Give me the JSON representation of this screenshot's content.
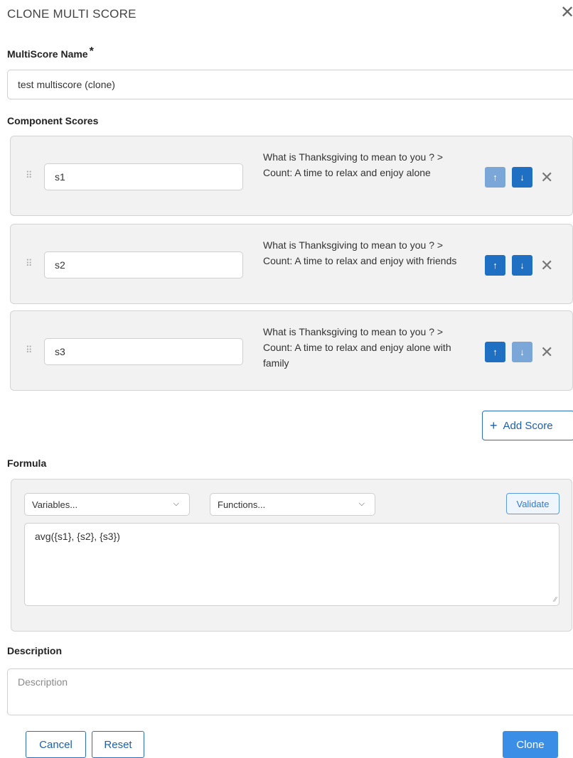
{
  "dialog": {
    "title": "CLONE MULTI SCORE",
    "close_symbol": "✕"
  },
  "name_field": {
    "label": "MultiScore Name",
    "required_mark": "*",
    "value": "test multiscore (clone)"
  },
  "component_scores": {
    "label": "Component Scores",
    "items": [
      {
        "variable": "s1",
        "description": "What is Thanksgiving to mean to you ? > Count: A time to relax and enjoy alone",
        "up_enabled": false,
        "down_enabled": true
      },
      {
        "variable": "s2",
        "description": "What is Thanksgiving to mean to you ? > Count: A time to relax and enjoy with friends",
        "up_enabled": true,
        "down_enabled": true
      },
      {
        "variable": "s3",
        "description": "What is Thanksgiving to mean to you ? > Count: A time to relax and enjoy alone with family",
        "up_enabled": true,
        "down_enabled": false
      }
    ],
    "add_button": "Add Score",
    "up_symbol": "↑",
    "down_symbol": "↓",
    "remove_symbol": "✕",
    "drag_symbol": "⠿"
  },
  "formula": {
    "label": "Formula",
    "variables_select": "Variables...",
    "functions_select": "Functions...",
    "validate_button": "Validate",
    "value": "avg({s1}, {s2}, {s3})"
  },
  "description": {
    "label": "Description",
    "placeholder": "Description"
  },
  "footer": {
    "cancel": "Cancel",
    "reset": "Reset",
    "clone": "Clone"
  },
  "colors": {
    "primary": "#1f6fc2",
    "primary_disabled": "#7aa6d8",
    "clone_button": "#3a8ee6",
    "card_background": "#f2f2f2"
  },
  "icons": {
    "close": "close-icon",
    "drag": "drag-handle-icon",
    "up": "arrow-up-icon",
    "down": "arrow-down-icon",
    "remove": "remove-icon",
    "plus": "plus-icon",
    "chevron": "chevron-down-icon",
    "resize": "resize-grip-icon"
  }
}
